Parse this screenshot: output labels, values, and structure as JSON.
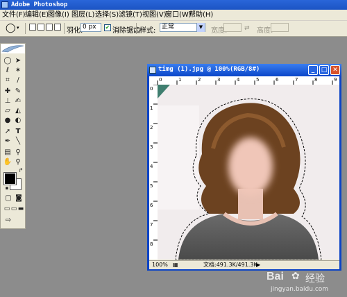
{
  "app": {
    "title": "Adobe Photoshop"
  },
  "menu": [
    "文件(F)",
    "编辑(E)",
    "图像(I)",
    "图层(L)",
    "选择(S)",
    "滤镜(T)",
    "视图(V)",
    "窗口(W)",
    "帮助(H)"
  ],
  "options": {
    "feather_label": "羽化:",
    "feather_value": "0 px",
    "antialias_label": "消除锯齿",
    "style_label": "样式:",
    "style_value": "正常",
    "width_label": "宽度:",
    "height_label": "高度:"
  },
  "document": {
    "title": "timg (1).jpg @ 100%(RGB/8#)",
    "zoom": "100%",
    "doc_info": "文档:491.3K/491.3K",
    "ruler_top": [
      "0",
      "1",
      "2",
      "3",
      "4",
      "5",
      "6",
      "7",
      "8",
      "9"
    ],
    "ruler_left": [
      "0",
      "1",
      "2",
      "3",
      "4",
      "5",
      "6",
      "7",
      "8"
    ]
  },
  "watermark": {
    "brand": "Bai",
    "brand2": "经验",
    "url": "jingyan.baidu.com"
  },
  "colors": {
    "workspace": "#8c8c8c",
    "titlebar": "#1b54c4",
    "chrome": "#ece9d8",
    "foreground": "#000000",
    "background": "#ffffff"
  }
}
